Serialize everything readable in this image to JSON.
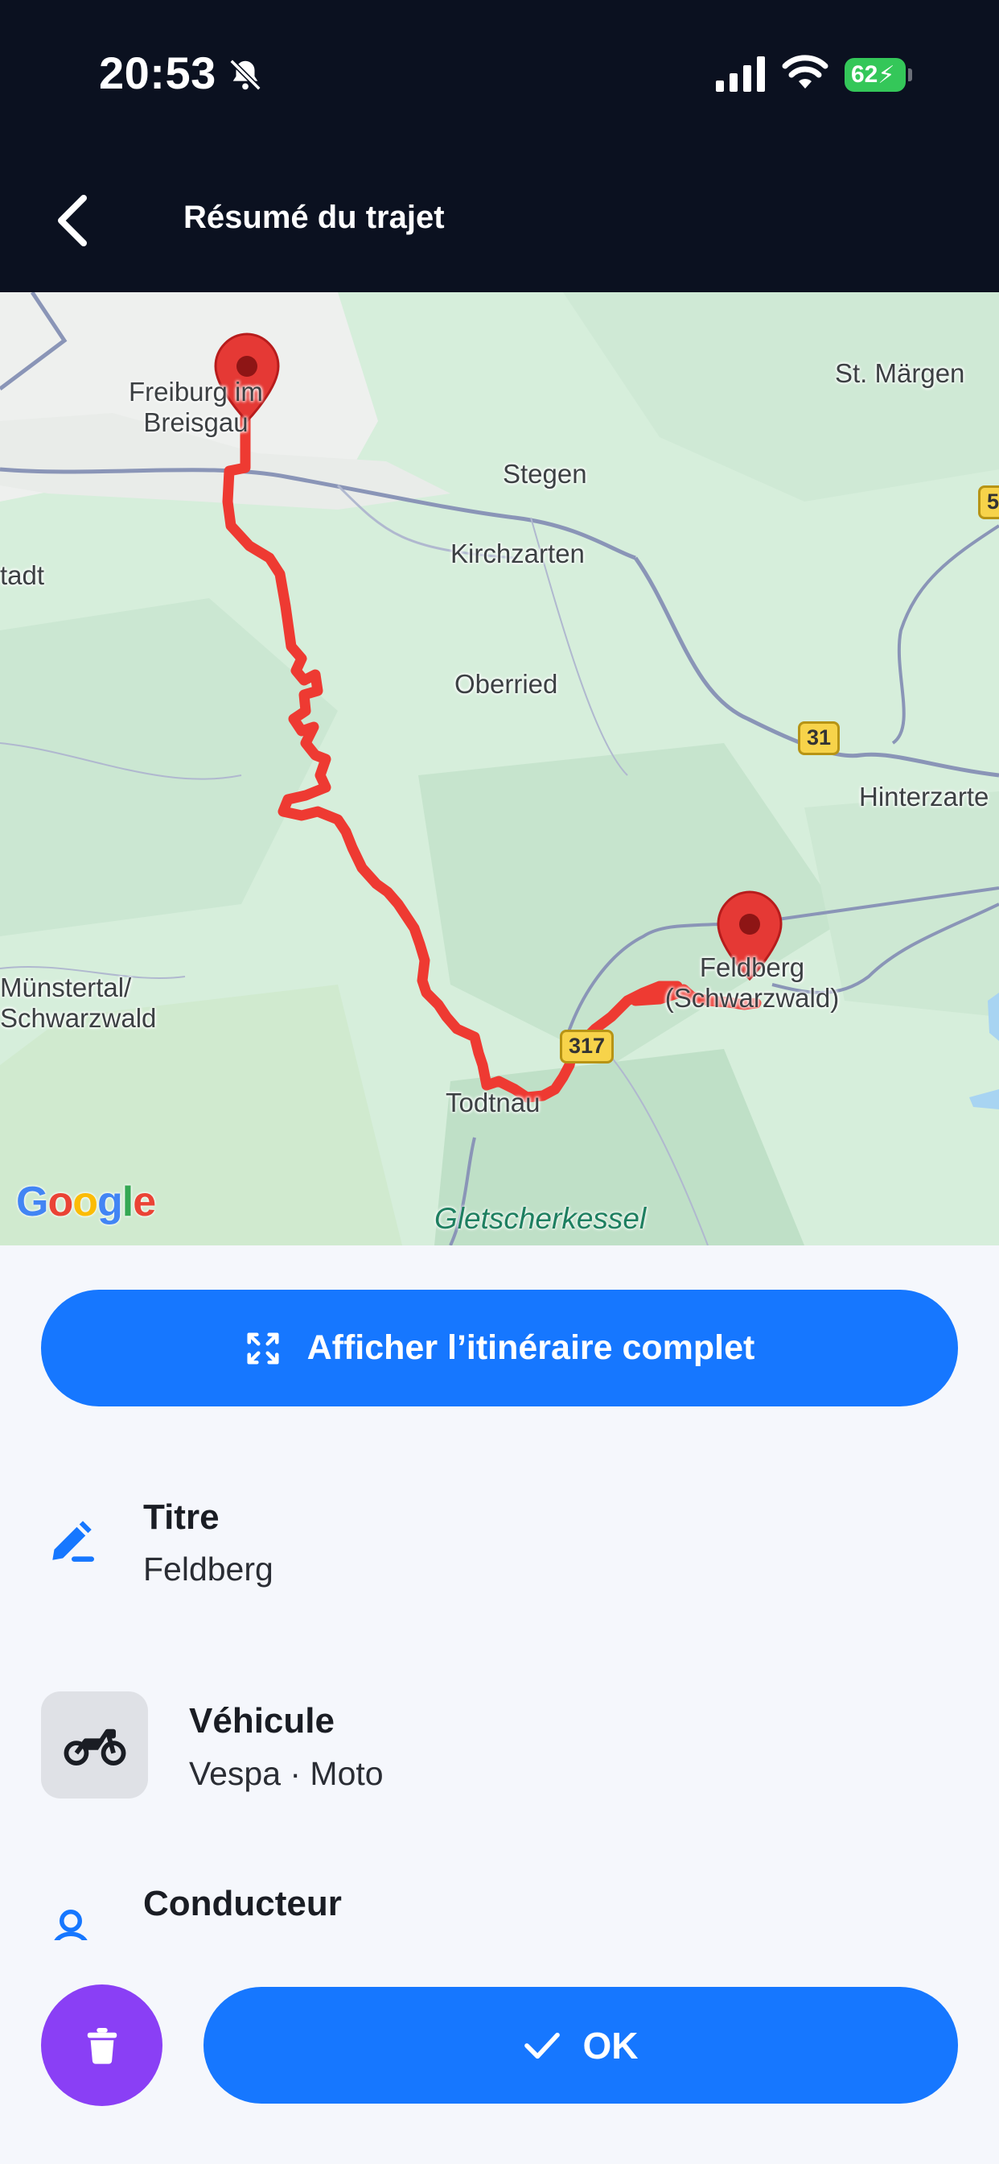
{
  "status_bar": {
    "time": "20:53",
    "battery": "62",
    "icons": [
      "bell-slash-icon",
      "signal-icon",
      "wifi-icon",
      "battery-charging-icon"
    ]
  },
  "header": {
    "title": "Résumé du trajet",
    "back_icon": "chevron-left-icon"
  },
  "map": {
    "places": {
      "freiburg": "Freiburg im Breisgau",
      "st_margen": "St. Märgen",
      "stegen": "Stegen",
      "kirchzarten": "Kirchzarten",
      "stadt": "tadt",
      "oberried": "Oberried",
      "hinterzarten": "Hinterzarte",
      "munstertal": "Münstertal/ Schwarzwald",
      "feldberg": "Feldberg (Schwarzwald)",
      "todtnau": "Todtnau",
      "gletscherkessel": "Gletscherkessel"
    },
    "road_shields": {
      "b31": "31",
      "b317": "317",
      "edge": "5"
    },
    "route_color": "#ee3a32",
    "markers": [
      "start-pin-icon",
      "end-pin-icon"
    ],
    "attribution": {
      "g1": "G",
      "o1": "o",
      "o2": "o",
      "g2": "g",
      "l": "l",
      "e": "e"
    }
  },
  "actions": {
    "full_route_label": "Afficher l’itinéraire complet",
    "full_route_icon": "expand-icon"
  },
  "details": {
    "title": {
      "label": "Titre",
      "value": "Feldberg",
      "icon": "pencil-icon"
    },
    "vehicle": {
      "label": "Véhicule",
      "value": "Vespa · Moto",
      "icon": "motorcycle-icon"
    },
    "driver": {
      "label": "Conducteur",
      "icon": "person-icon"
    }
  },
  "footer": {
    "ok_label": "OK",
    "delete_icon": "trash-icon",
    "ok_icon": "checkmark-icon"
  },
  "colors": {
    "accent": "#1677ff",
    "delete": "#8a3ff5",
    "topbar": "#0b1120"
  }
}
